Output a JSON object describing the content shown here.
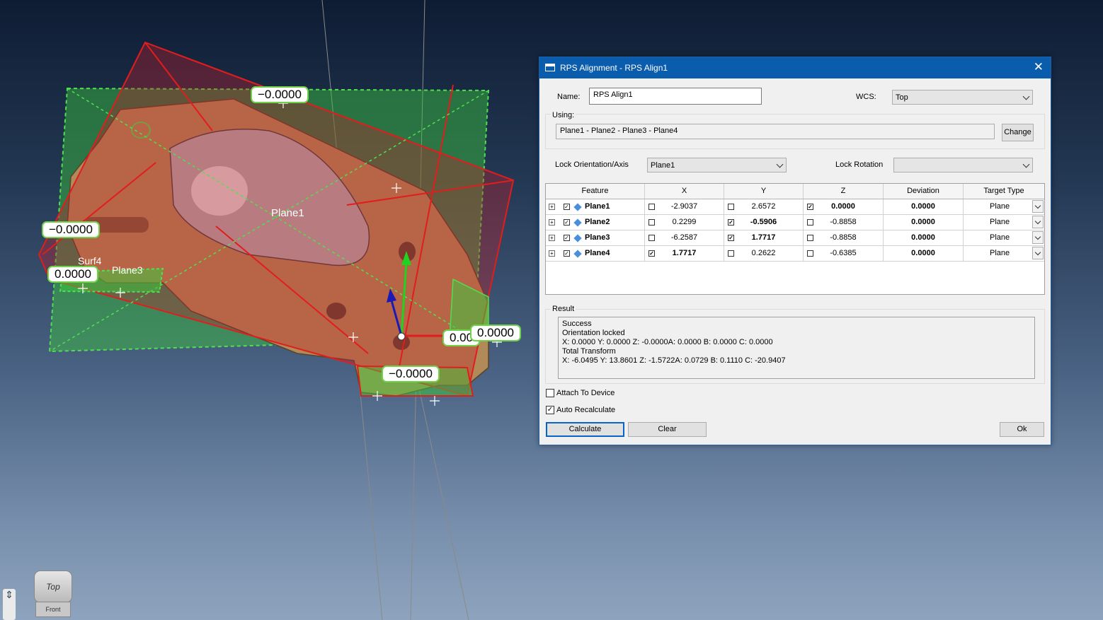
{
  "viewport": {
    "measure_labels": [
      "−0.0000",
      "−0.0000",
      "0.0000",
      "0.0000",
      "−0.0000",
      "0.00"
    ],
    "plane_labels": [
      "Plane1",
      "Surf4",
      "Plane3"
    ],
    "viewcube": {
      "top": "Top",
      "front": "Front"
    },
    "colors": {
      "part": "#b08a58",
      "red_plane": "#d42a2a",
      "green_plane": "#3ec43e"
    }
  },
  "dialog": {
    "title": "RPS Alignment - RPS Align1",
    "close_icon": "close-icon",
    "name_label": "Name:",
    "name_value": "RPS Align1",
    "wcs_label": "WCS:",
    "wcs_value": "Top",
    "using_label": "Using:",
    "using_value": "Plane1 - Plane2 - Plane3 - Plane4",
    "change_label": "Change",
    "lock_orientation_label": "Lock Orientation/Axis",
    "lock_orientation_value": "Plane1",
    "lock_rotation_label": "Lock Rotation",
    "lock_rotation_value": "",
    "grid": {
      "headers": [
        "Feature",
        "X",
        "Y",
        "Z",
        "Deviation",
        "Target Type"
      ],
      "rows": [
        {
          "feature": "Plane1",
          "x": "-2.9037",
          "y": "2.6572",
          "z": "0.0000",
          "deviation": "0.0000",
          "target": "Plane",
          "xc": false,
          "yc": false,
          "zc": true
        },
        {
          "feature": "Plane2",
          "x": "0.2299",
          "y": "-0.5906",
          "z": "-0.8858",
          "deviation": "0.0000",
          "target": "Plane",
          "xc": false,
          "yc": true,
          "zc": false
        },
        {
          "feature": "Plane3",
          "x": "-6.2587",
          "y": "1.7717",
          "z": "-0.8858",
          "deviation": "0.0000",
          "target": "Plane",
          "xc": false,
          "yc": true,
          "zc": false
        },
        {
          "feature": "Plane4",
          "x": "1.7717",
          "y": "0.2622",
          "z": "-0.6385",
          "deviation": "0.0000",
          "target": "Plane",
          "xc": true,
          "yc": false,
          "zc": false
        }
      ]
    },
    "result_label": "Result",
    "result_lines": [
      "Success",
      "Orientation locked",
      "X: 0.0000 Y: 0.0000 Z: -0.0000A: 0.0000 B: 0.0000 C: 0.0000",
      "Total Transform",
      "X: -6.0495 Y: 13.8601 Z: -1.5722A: 0.0729 B: 0.1110 C: -20.9407"
    ],
    "attach_label": "Attach To Device",
    "attach_checked": false,
    "auto_label": "Auto Recalculate",
    "auto_checked": true,
    "calculate_label": "Calculate",
    "clear_label": "Clear",
    "ok_label": "Ok"
  }
}
